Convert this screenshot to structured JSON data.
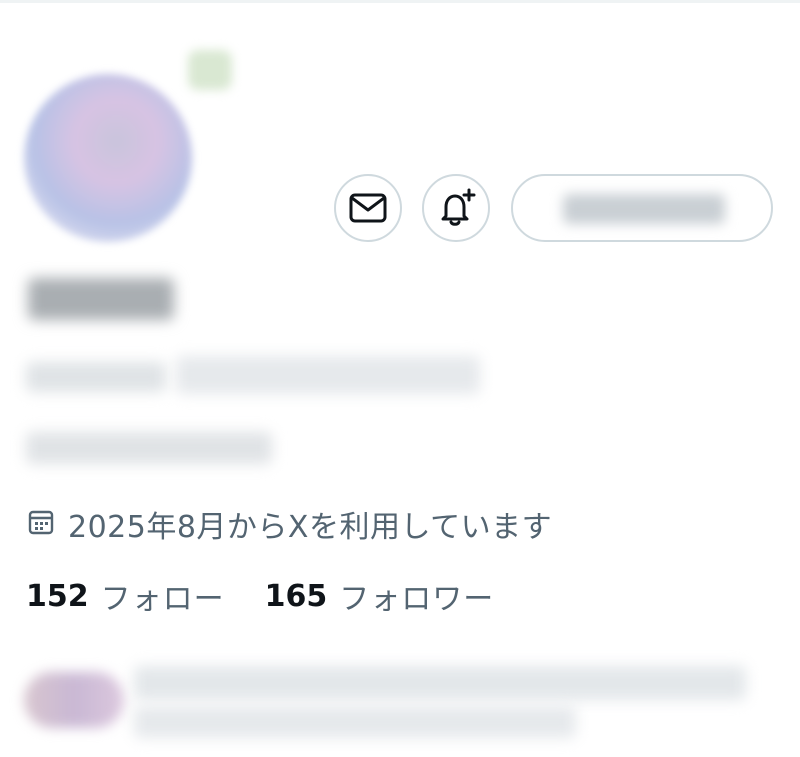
{
  "profile": {
    "join_date": "2025年8月からXを利用しています",
    "following_count": "152",
    "following_label": "フォロー",
    "followers_count": "165",
    "followers_label": "フォロワー"
  },
  "icons": {
    "dm": "mail-icon",
    "notify": "bell-plus-icon",
    "calendar": "calendar-icon"
  },
  "colors": {
    "text_primary": "#0f1419",
    "text_secondary": "#536471",
    "border": "#cfd9de"
  }
}
